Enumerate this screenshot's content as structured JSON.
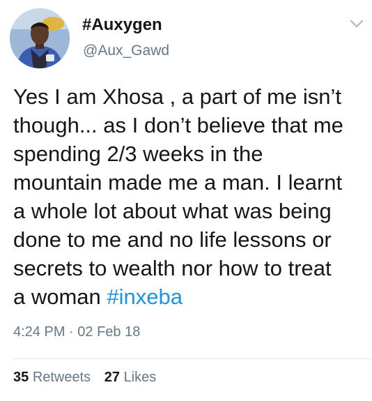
{
  "author": {
    "display_name": "#Auxygen",
    "handle": "@Aux_Gawd"
  },
  "tweet": {
    "lines": [
      "Yes I am Xhosa , a part of me isn’t",
      "though... as I don’t believe that me",
      "spending 2/3 weeks in the",
      "mountain made me a man. I learnt",
      "a whole lot about what was being",
      "done to me and no life lessons or",
      "secrets to wealth nor how to treat"
    ],
    "last_line_prefix": "a woman ",
    "hashtag": "#inxeba",
    "time": "4:24 PM",
    "separator": "·",
    "date": "02 Feb 18"
  },
  "stats": {
    "retweets_count": "35",
    "retweets_label": "Retweets",
    "likes_count": "27",
    "likes_label": "Likes"
  },
  "icons": {
    "menu": "chevron-down-icon"
  },
  "colors": {
    "text": "#14171a",
    "secondary_text": "#657786",
    "link": "#1b95e0",
    "divider": "#e1e8ed",
    "chevron": "#aab8c2"
  }
}
